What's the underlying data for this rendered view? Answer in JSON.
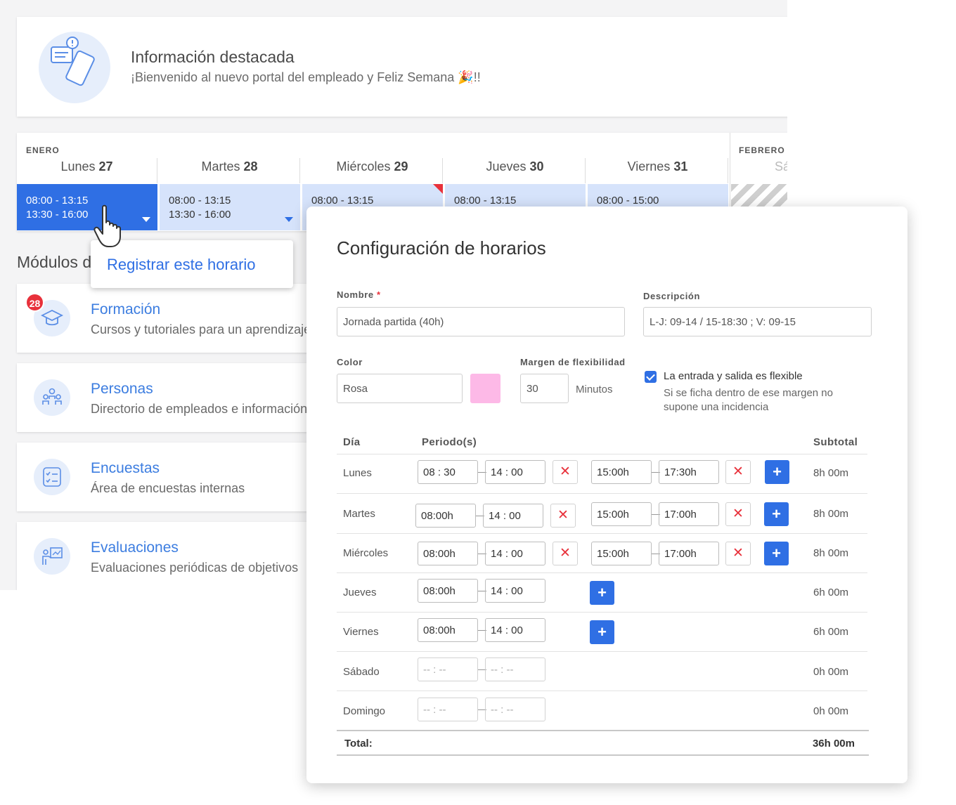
{
  "info": {
    "title": "Información destacada",
    "subtitle": "¡Bienvenido al nuevo portal del empleado y Feliz Semana 🎉!!"
  },
  "calendar": {
    "month1": "ENERO",
    "month2": "FEBRERO",
    "days": [
      {
        "name": "Lunes",
        "num": "27",
        "line1": "08:00 - 13:15",
        "line2": "13:30 - 16:00"
      },
      {
        "name": "Martes",
        "num": "28",
        "line1": "08:00 - 13:15",
        "line2": "13:30 - 16:00"
      },
      {
        "name": "Miércoles",
        "num": "29",
        "line1": "08:00 - 13:15",
        "line2": ""
      },
      {
        "name": "Jueves",
        "num": "30",
        "line1": "08:00 - 13:15",
        "line2": ""
      },
      {
        "name": "Viernes",
        "num": "31",
        "line1": "08:00 - 15:00",
        "line2": ""
      }
    ],
    "next_day_partial": "Sá"
  },
  "tooltip": "Registrar este horario",
  "modules": {
    "title": "Módulos d",
    "items": [
      {
        "title": "Formación",
        "desc": "Cursos y tutoriales para un aprendizaje",
        "badge": "28",
        "icon": "graduation-cap-icon"
      },
      {
        "title": "Personas",
        "desc": "Directorio de empleados e información",
        "icon": "people-icon"
      },
      {
        "title": "Encuestas",
        "desc": "Área de encuestas internas",
        "icon": "checklist-icon"
      },
      {
        "title": "Evaluaciones",
        "desc": "Evaluaciones periódicas de objetivos",
        "icon": "presentation-icon"
      }
    ]
  },
  "modal": {
    "title": "Configuración de horarios",
    "nombre_label": "Nombre",
    "nombre_required": "*",
    "nombre_value": "Jornada partida (40h)",
    "descripcion_label": "Descripción",
    "descripcion_value": "L-J: 09-14 / 15-18:30 ; V: 09-15",
    "color_label": "Color",
    "color_value": "Rosa",
    "color_swatch": "#fdb9e7",
    "margen_label": "Margen de flexibilidad",
    "margen_value": "30",
    "margen_unit": "Minutos",
    "flex_checked": true,
    "flex_title": "La entrada y salida es flexible",
    "flex_help": "Si se ficha dentro de ese margen no supone una incidencia",
    "col_dia": "Día",
    "col_periodos": "Periodo(s)",
    "col_subtotal": "Subtotal",
    "rows": [
      {
        "day": "Lunes",
        "p1_start": "08  :  30",
        "p1_end": "14  :  00",
        "p2_start": "15:00h",
        "p2_end": "17:30h",
        "subtotal": "8h 00m"
      },
      {
        "day": "Martes",
        "p1_start": "08:00h",
        "p1_end": "14  :  00",
        "p2_start": "15:00h",
        "p2_end": "17:00h",
        "subtotal": "8h 00m"
      },
      {
        "day": "Miércoles",
        "p1_start": "08:00h",
        "p1_end": "14  :  00",
        "p2_start": "15:00h",
        "p2_end": "17:00h",
        "subtotal": "8h 00m"
      },
      {
        "day": "Jueves",
        "p1_start": "08:00h",
        "p1_end": "14  :  00",
        "subtotal": "6h 00m"
      },
      {
        "day": "Viernes",
        "p1_start": "08:00h",
        "p1_end": "14  :  00",
        "subtotal": "6h 00m"
      },
      {
        "day": "Sábado",
        "p1_start": "--  :  --",
        "p1_end": "--  :  --",
        "subtotal": "0h 00m"
      },
      {
        "day": "Domingo",
        "p1_start": "--  :  --",
        "p1_end": "--  :  --",
        "subtotal": "0h 00m"
      }
    ],
    "total_label": "Total:",
    "total_value": "36h 00m",
    "remove_symbol": "✕",
    "add_symbol": "+"
  },
  "colors": {
    "accent": "#2f6fe4",
    "danger": "#e8313b",
    "slot_bg": "#d6e3fb"
  }
}
